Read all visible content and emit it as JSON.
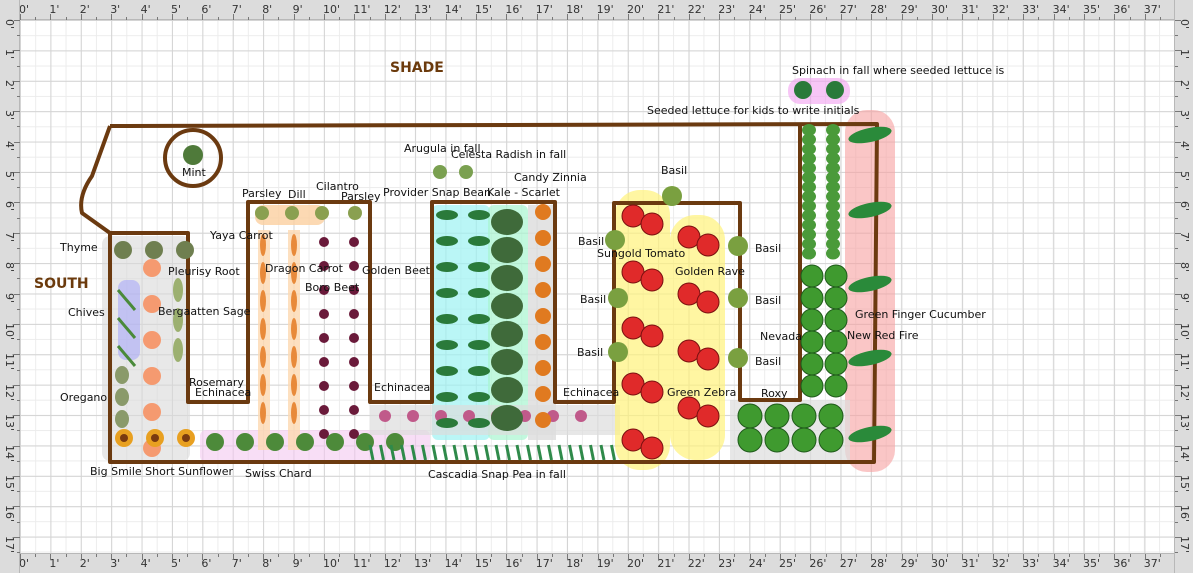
{
  "ruler": {
    "x_labels": [
      "0'",
      "1'",
      "2'",
      "3'",
      "4'",
      "5'",
      "6'",
      "7'",
      "8'",
      "9'",
      "10'",
      "11'",
      "12'",
      "13'",
      "14'",
      "15'",
      "16'",
      "17'",
      "18'",
      "19'",
      "20'",
      "21'",
      "22'",
      "23'",
      "24'",
      "25'",
      "26'",
      "27'",
      "28'",
      "29'",
      "30'",
      "31'",
      "32'",
      "33'",
      "34'",
      "35'",
      "36'",
      "37'"
    ],
    "y_labels": [
      "0'",
      "1'",
      "2'",
      "3'",
      "4'",
      "5'",
      "6'",
      "7'",
      "8'",
      "9'",
      "10'",
      "11'",
      "12'",
      "13'",
      "14'",
      "15'",
      "16'",
      "17'"
    ]
  },
  "colors": {
    "bed_border": "#6b3a10",
    "tomato_highlight": "#fff27a",
    "cucumber_highlight": "#f7a0a0",
    "spinach_highlight": "#f2a0f0",
    "chives_highlight": "#a8a8f8",
    "bean_highlight": "#9cf2f2"
  },
  "directions": {
    "shade": "SHADE",
    "south": "SOUTH"
  },
  "labels": {
    "spinach": "Spinach in fall where seeded lettuce is",
    "seeded_lettuce": "Seeded lettuce for kids to write initials",
    "mint": "Mint",
    "arugula": "Arugula in fall",
    "radish": "Celesta Radish in fall",
    "zinnia": "Candy Zinnia",
    "basil_top": "Basil",
    "parsley_1": "Parsley",
    "dill": "Dill",
    "cilantro": "Cilantro",
    "parsley_2": "Parsley",
    "snap_bean": "Provider Snap Bean",
    "kale": "Kale - Scarlet",
    "thyme": "Thyme",
    "yaya_carrot": "Yaya Carrot",
    "basil_l1": "Basil",
    "sungold": "Sungold Tomato",
    "basil_r1": "Basil",
    "pleurisy": "Pleurisy Root",
    "dragon_carrot": "Dragon Carrot",
    "golden_beet": "Golden Beet",
    "golden_rave": "Golden Rave",
    "boro_beet": "Boro Beet",
    "chives": "Chives",
    "sage": "Bergaatten Sage",
    "basil_l2": "Basil",
    "basil_r2": "Basil",
    "cucumber": "Green Finger Cucumber",
    "nevada": "Nevada",
    "new_red_fire": "New Red Fire",
    "basil_l3": "Basil",
    "basil_r3": "Basil",
    "rosemary": "Rosemary",
    "echinacea_1": "Echinacea",
    "echinacea_2": "Echinacea",
    "echinacea_3": "Echinacea",
    "green_zebra": "Green Zebra",
    "roxy": "Roxy",
    "oregano": "Oregano",
    "sunflower": "Big Smile Short Sunflower",
    "swiss_chard": "Swiss Chard",
    "snap_pea": "Cascadia Snap Pea in fall"
  }
}
